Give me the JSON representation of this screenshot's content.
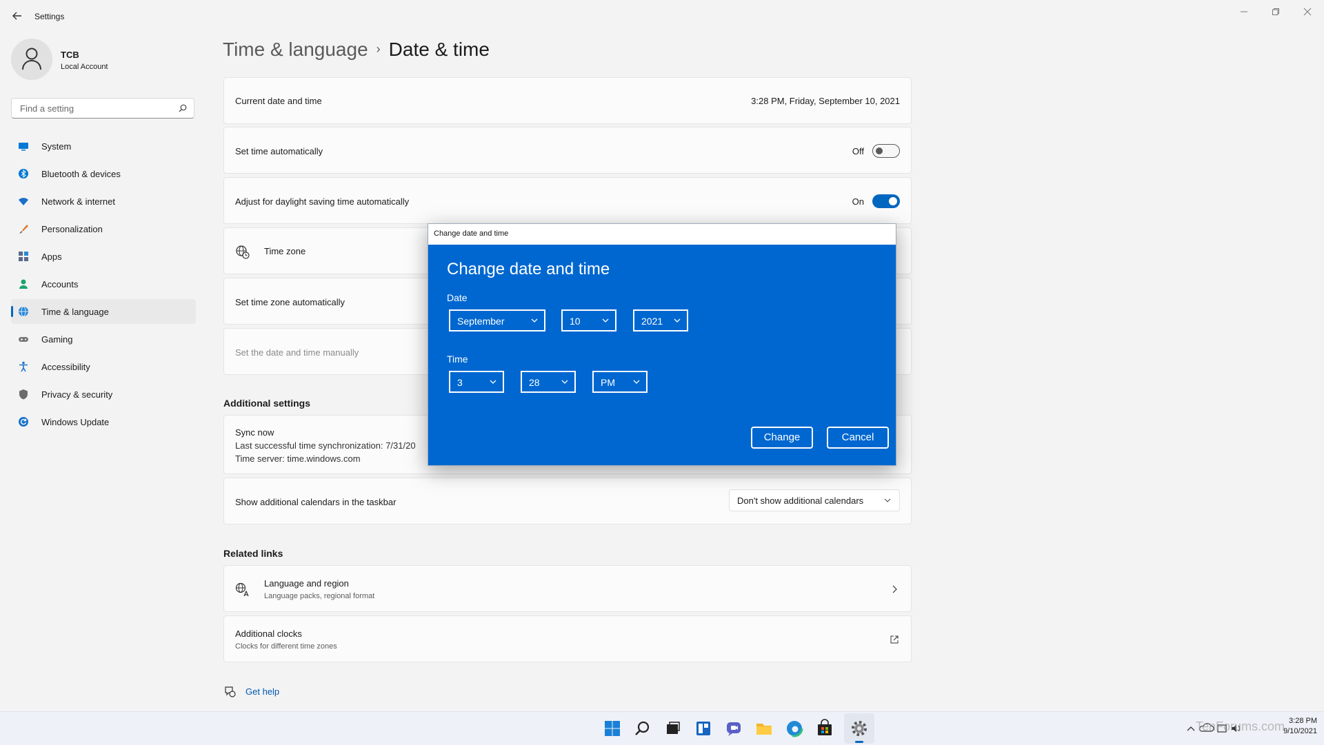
{
  "window": {
    "title": "Settings"
  },
  "user": {
    "name": "TCB",
    "account_type": "Local Account"
  },
  "search": {
    "placeholder": "Find a setting"
  },
  "nav": [
    {
      "label": "System",
      "icon": "monitor-icon",
      "color": "#0078d4"
    },
    {
      "label": "Bluetooth & devices",
      "icon": "bluetooth-icon",
      "color": "#0078d4"
    },
    {
      "label": "Network & internet",
      "icon": "wifi-icon",
      "color": "#1b6fc8"
    },
    {
      "label": "Personalization",
      "icon": "brush-icon",
      "color": "#e07b2c"
    },
    {
      "label": "Apps",
      "icon": "apps-icon",
      "color": "#5a6b8c"
    },
    {
      "label": "Accounts",
      "icon": "person-icon",
      "color": "#1aa36a"
    },
    {
      "label": "Time & language",
      "icon": "globe-clock-icon",
      "color": "#2b88d8"
    },
    {
      "label": "Gaming",
      "icon": "gamepad-icon",
      "color": "#777777"
    },
    {
      "label": "Accessibility",
      "icon": "accessibility-icon",
      "color": "#1a73c9"
    },
    {
      "label": "Privacy & security",
      "icon": "shield-icon",
      "color": "#6b6b6b"
    },
    {
      "label": "Windows Update",
      "icon": "update-icon",
      "color": "#1a73c9"
    }
  ],
  "active_nav": "Time & language",
  "breadcrumb": {
    "parent": "Time & language",
    "separator": "›",
    "current": "Date & time"
  },
  "settings": {
    "current_datetime": {
      "label": "Current date and time",
      "value": "3:28 PM, Friday, September 10, 2021"
    },
    "set_time_auto": {
      "label": "Set time automatically",
      "state": "Off"
    },
    "daylight": {
      "label": "Adjust for daylight saving time automatically",
      "state": "On"
    },
    "timezone": {
      "label": "Time zone"
    },
    "set_tz_auto": {
      "label": "Set time zone automatically"
    },
    "manual": {
      "label": "Set the date and time manually"
    }
  },
  "additional": {
    "heading": "Additional settings",
    "sync": {
      "label": "Sync now",
      "last_sync": "Last successful time synchronization: 7/31/20",
      "server": "Time server: time.windows.com"
    },
    "calendars": {
      "label": "Show additional calendars in the taskbar",
      "value": "Don't show additional calendars"
    }
  },
  "related": {
    "heading": "Related links",
    "language": {
      "label": "Language and region",
      "sub": "Language packs, regional format"
    },
    "clocks": {
      "label": "Additional clocks",
      "sub": "Clocks for different time zones"
    }
  },
  "help": {
    "label": "Get help"
  },
  "dialog": {
    "window_title": "Change date and time",
    "heading": "Change date and time",
    "date_label": "Date",
    "month": "September",
    "day": "10",
    "year": "2021",
    "time_label": "Time",
    "hour": "3",
    "minute": "28",
    "ampm": "PM",
    "change_button": "Change",
    "cancel_button": "Cancel",
    "accent": "#0067d0"
  },
  "taskbar": {
    "clock_time": "3:28 PM",
    "clock_date": "9/10/2021",
    "watermark": "TenForums.com"
  },
  "colors": {
    "accent": "#0067c0",
    "background": "#f3f3f3",
    "card": "#fbfbfb"
  }
}
